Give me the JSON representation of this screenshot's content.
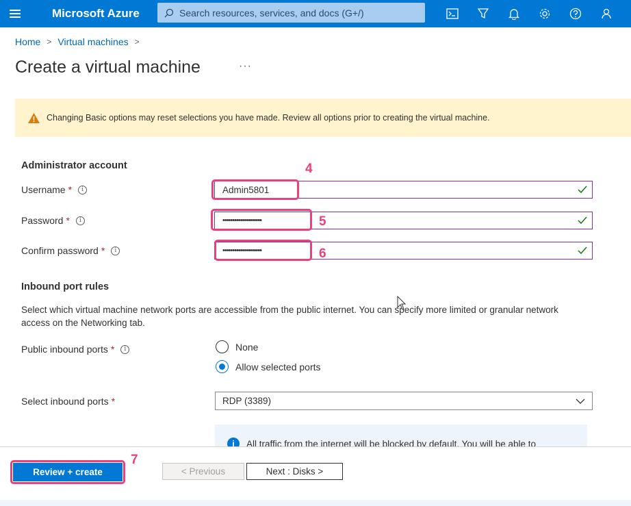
{
  "header": {
    "brand": "Microsoft Azure",
    "search_placeholder": "Search resources, services, and docs (G+/)",
    "icons": [
      "menu-icon",
      "cloud-shell-icon",
      "directory-filter-icon",
      "bell-icon",
      "gear-icon",
      "help-icon",
      "feedback-icon"
    ]
  },
  "breadcrumb": {
    "home": "Home",
    "vms": "Virtual machines"
  },
  "page": {
    "title": "Create a virtual machine",
    "more": "···"
  },
  "warning": {
    "text": "Changing Basic options may reset selections you have made. Review all options prior to creating the virtual machine."
  },
  "admin": {
    "section_title": "Administrator account",
    "username_label": "Username",
    "username_value": "Admin5801",
    "password_label": "Password",
    "password_value": "••••••••••••••••••••",
    "confirm_label": "Confirm password",
    "confirm_value": "••••••••••••••••••••",
    "required_mark": "*",
    "info_glyph": "i"
  },
  "inbound": {
    "section_title": "Inbound port rules",
    "description": "Select which virtual machine network ports are accessible from the public internet. You can specify more limited or granular network access on the Networking tab.",
    "public_ports_label": "Public inbound ports",
    "option_none": "None",
    "option_allow": "Allow selected ports",
    "selected_option": "Allow selected ports",
    "select_ports_label": "Select inbound ports",
    "select_ports_value": "RDP (3389)",
    "info_text": "All traffic from the internet will be blocked by default. You will be able to"
  },
  "annotations": {
    "n4": "4",
    "n5": "5",
    "n6": "6",
    "n7": "7"
  },
  "footer": {
    "review_create": "Review + create",
    "previous": "< Previous",
    "next": "Next : Disks >"
  },
  "colors": {
    "brand_blue": "#0078d4",
    "highlight_pink": "#e8417b",
    "focus_purple": "#8a2da5",
    "warning_bg": "#fff4ce",
    "check_green": "#107c10"
  }
}
